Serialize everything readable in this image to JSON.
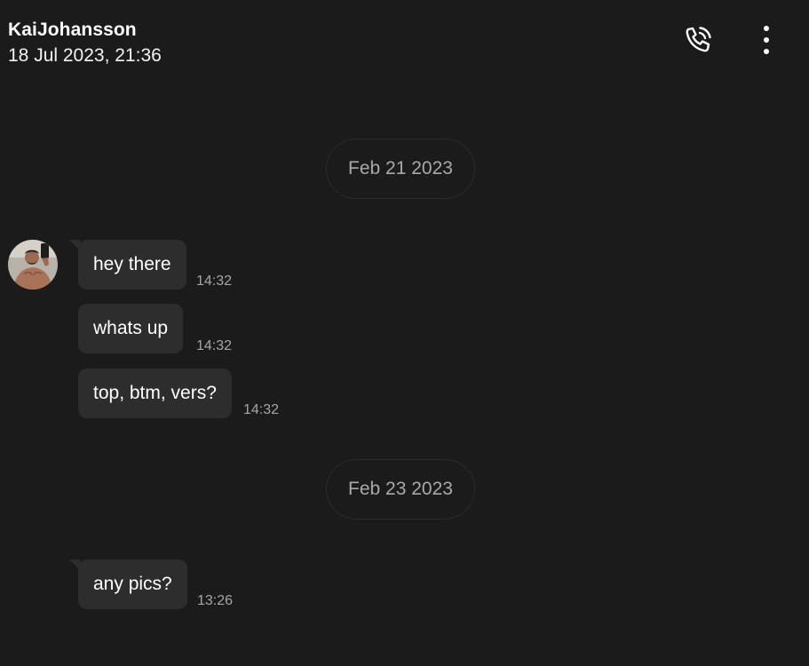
{
  "header": {
    "contact_name": "KaiJohansson",
    "timestamp": "18 Jul 2023, 21:36",
    "call_icon": "phone-call-icon",
    "menu_icon": "more-vertical-icon"
  },
  "conversation": {
    "date_separators": [
      "Feb 21 2023",
      "Feb 23 2023"
    ],
    "messages": [
      {
        "text": "hey there",
        "time": "14:32"
      },
      {
        "text": "whats up",
        "time": "14:32"
      },
      {
        "text": "top, btm, vers?",
        "time": "14:32"
      },
      {
        "text": "any pics?",
        "time": "13:26"
      }
    ]
  },
  "colors": {
    "background": "#1b1b1b",
    "bubble": "#2d2d2d",
    "muted_text": "#a9a9a9"
  }
}
